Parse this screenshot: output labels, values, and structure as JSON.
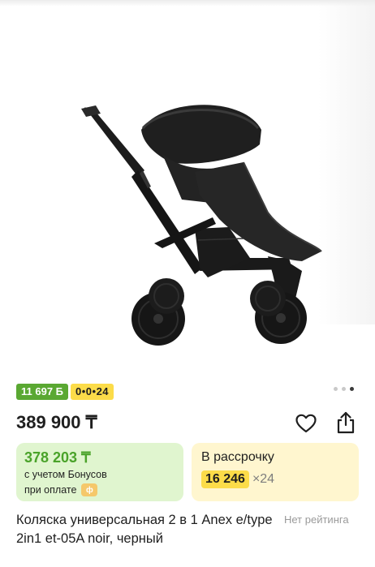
{
  "gallery": {
    "page_count": 3,
    "active_index": 2
  },
  "badges": {
    "bonus": "11 697 Б",
    "installment": "0•0•24"
  },
  "price": "389 900 ₸",
  "actions": {
    "favorite_icon": "heart-icon",
    "share_icon": "share-icon"
  },
  "bonus_card": {
    "price": "378 203 ₸",
    "line1": "с учетом Бонусов",
    "line2": "при оплате"
  },
  "installment_card": {
    "title": "В рассрочку",
    "amount": "16 246",
    "months": "×24"
  },
  "product": {
    "title": "Коляска универсальная 2 в 1 Anex e/type 2in1 et-05A noir, черный",
    "rating": "Нет рейтинга"
  },
  "colors": {
    "bonus_green": "#5aa832",
    "installment_yellow": "#fcdc49",
    "green_card_bg": "#e0f5cf",
    "yellow_card_bg": "#fff6cf"
  }
}
